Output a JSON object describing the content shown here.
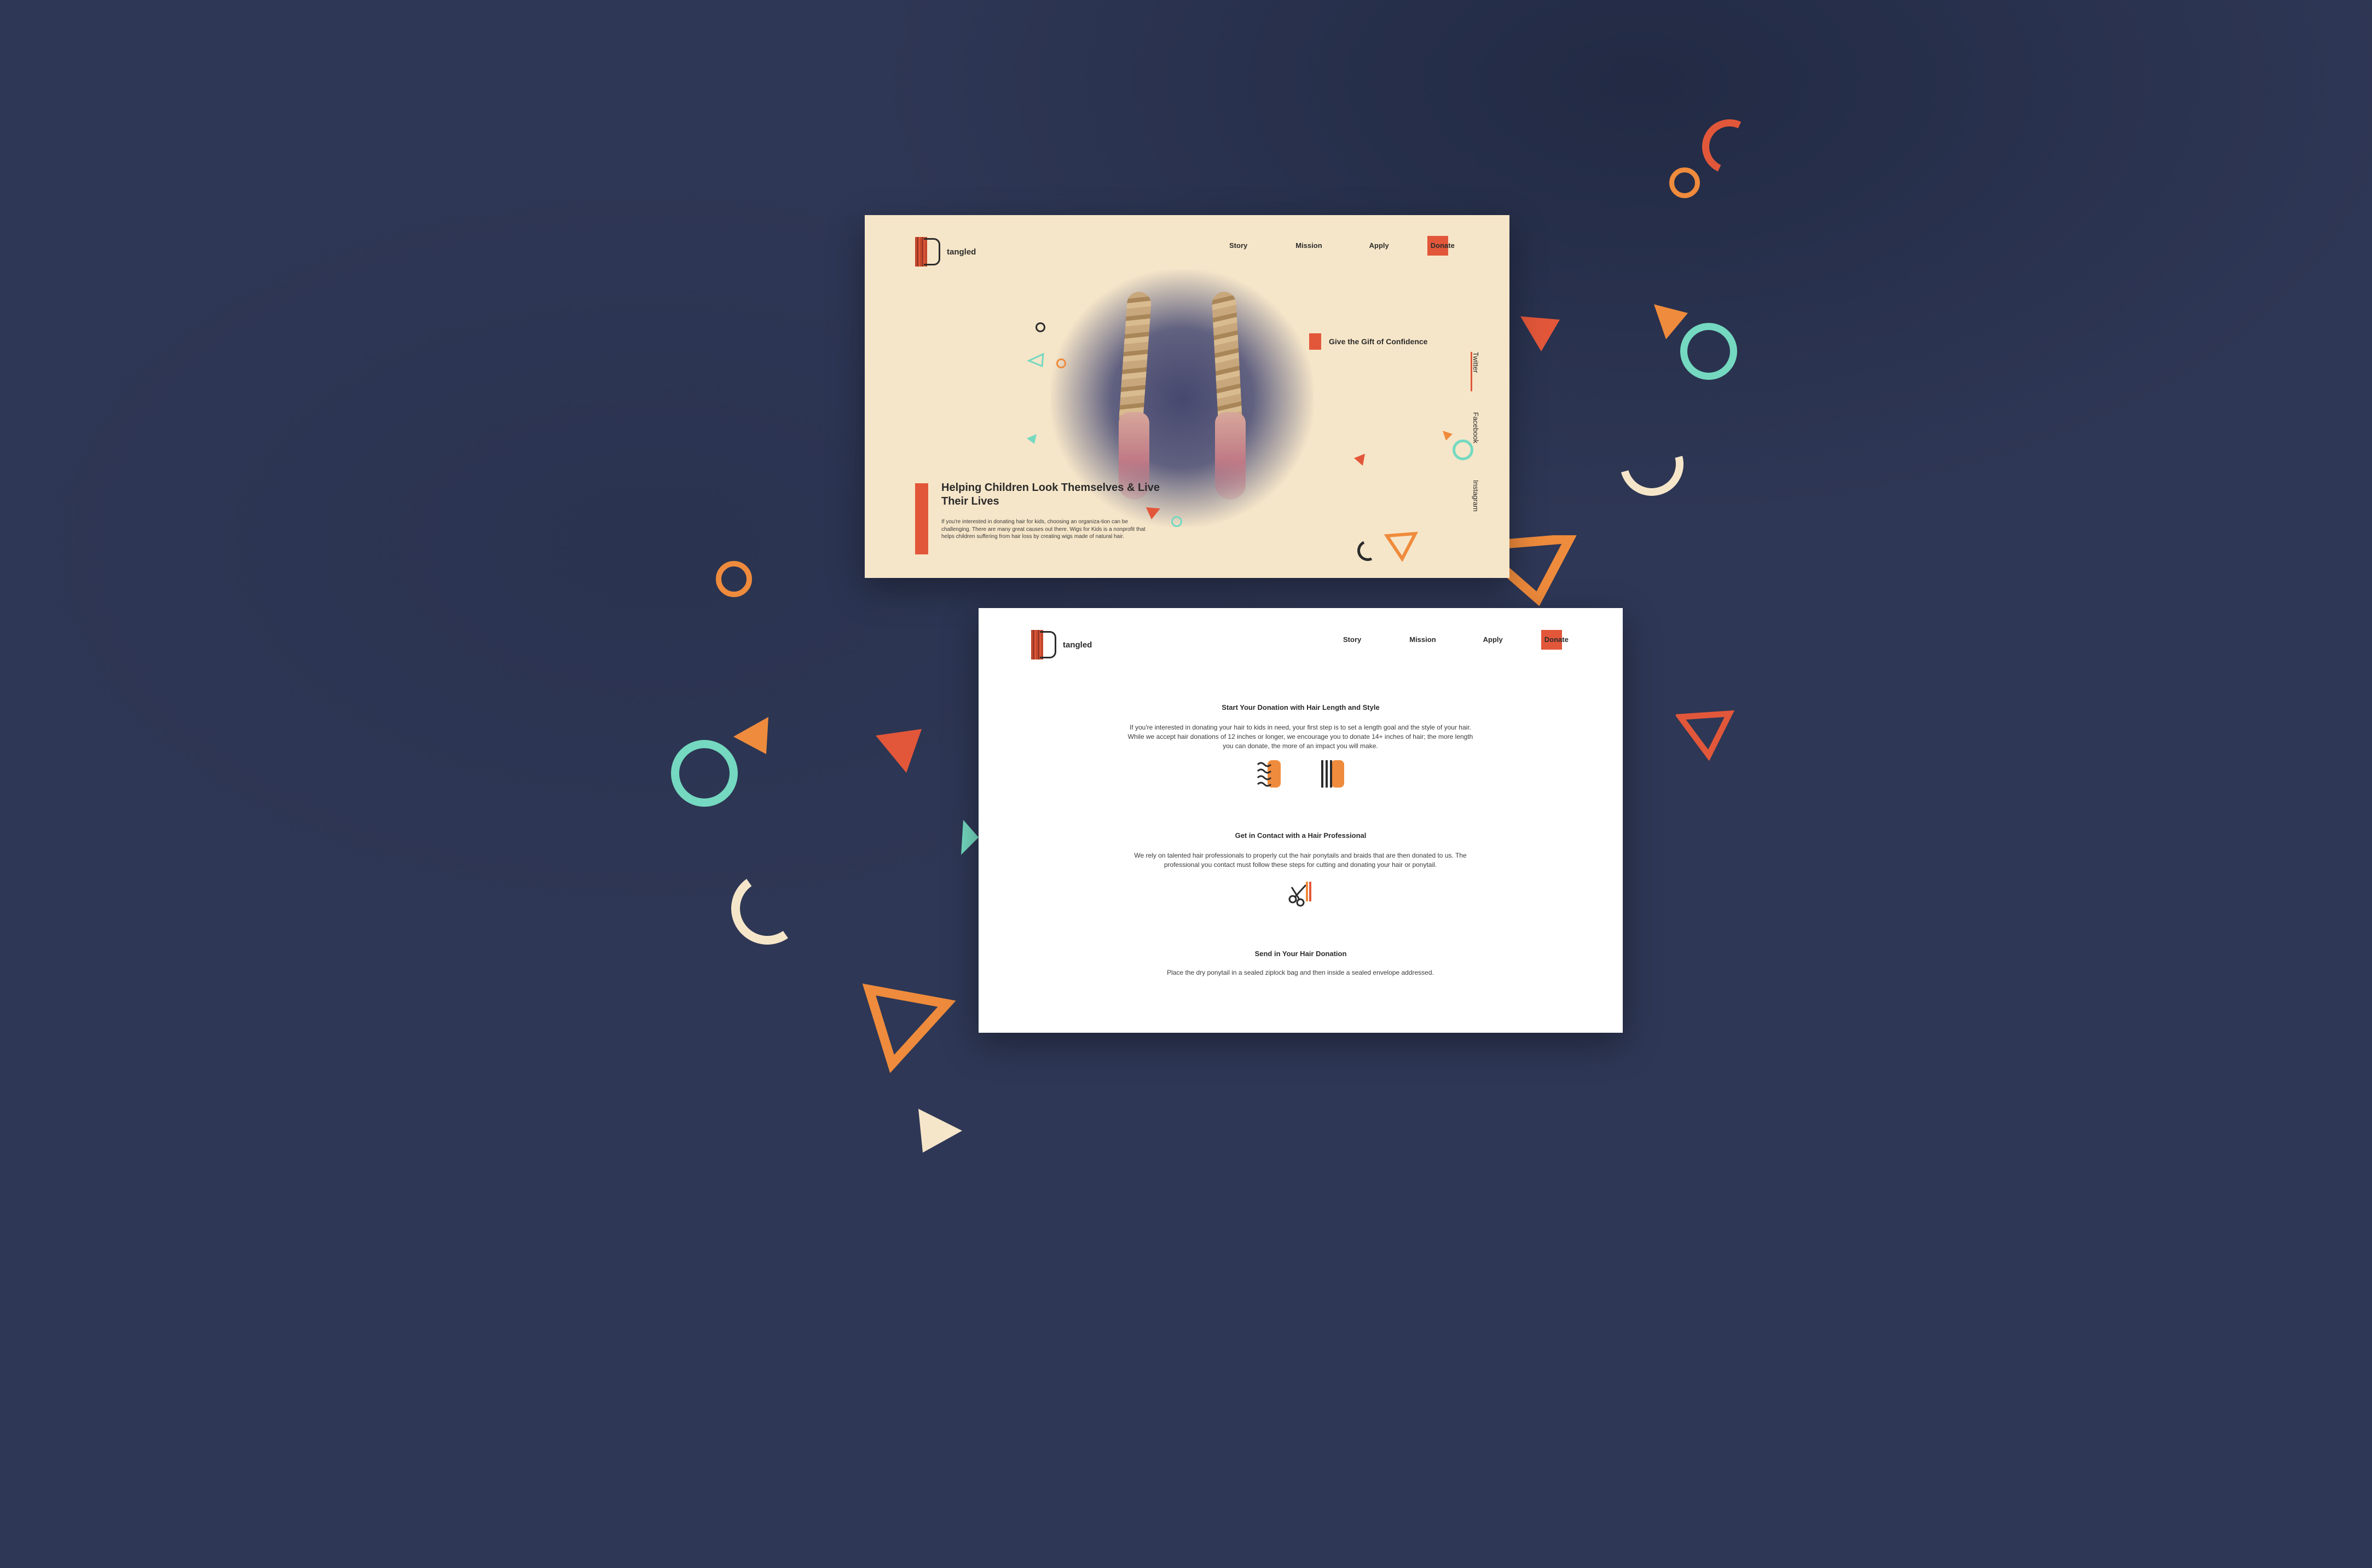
{
  "brand": {
    "name": "tangled"
  },
  "nav": {
    "story": "Story",
    "mission": "Mission",
    "apply": "Apply",
    "donate": "Donate"
  },
  "hero": {
    "tagline": "Give the Gift of Confidence",
    "title": "Helping Children Look Themselves & Live Their Lives",
    "body": "If you're interested in donating hair for kids, choosing an organiza-tion can be challenging. There are many great causes out there. Wigs for Kids is a nonprofit that helps children suffering from hair loss by creating wigs made of natural hair.",
    "socials": [
      "Twitter",
      "Facebook",
      "Instagram"
    ]
  },
  "steps": [
    {
      "title": "Start Your Donation with Hair Length and Style",
      "body": "If you're interested in donating your hair to kids in need, your first step is to set a length goal and the style of your hair. While we accept hair donations of 12 inches or longer, we encourage you to donate 14+ inches of hair; the more length you can donate, the more of an impact you will make.",
      "icons": [
        "wavy-hair-icon",
        "straight-hair-icon"
      ]
    },
    {
      "title": "Get in Contact with a Hair Professional",
      "body": "We rely on talented hair professionals to properly cut the hair ponytails and braids that are then donated to us. The professional you contact must follow these steps for cutting and donating your hair or ponytail.",
      "icons": [
        "scissors-icon"
      ]
    },
    {
      "title": "Send in Your Hair Donation",
      "body": "Place the dry ponytail in a sealed ziplock bag and then inside a sealed envelope addressed."
    }
  ],
  "colors": {
    "background": "#2e3755",
    "hero_bg": "#f6e6c9",
    "accent": "#e2573a",
    "orange": "#ef8b3c",
    "teal": "#74d9c0",
    "cream": "#f6e6c9",
    "dark": "#2b2b2b"
  }
}
